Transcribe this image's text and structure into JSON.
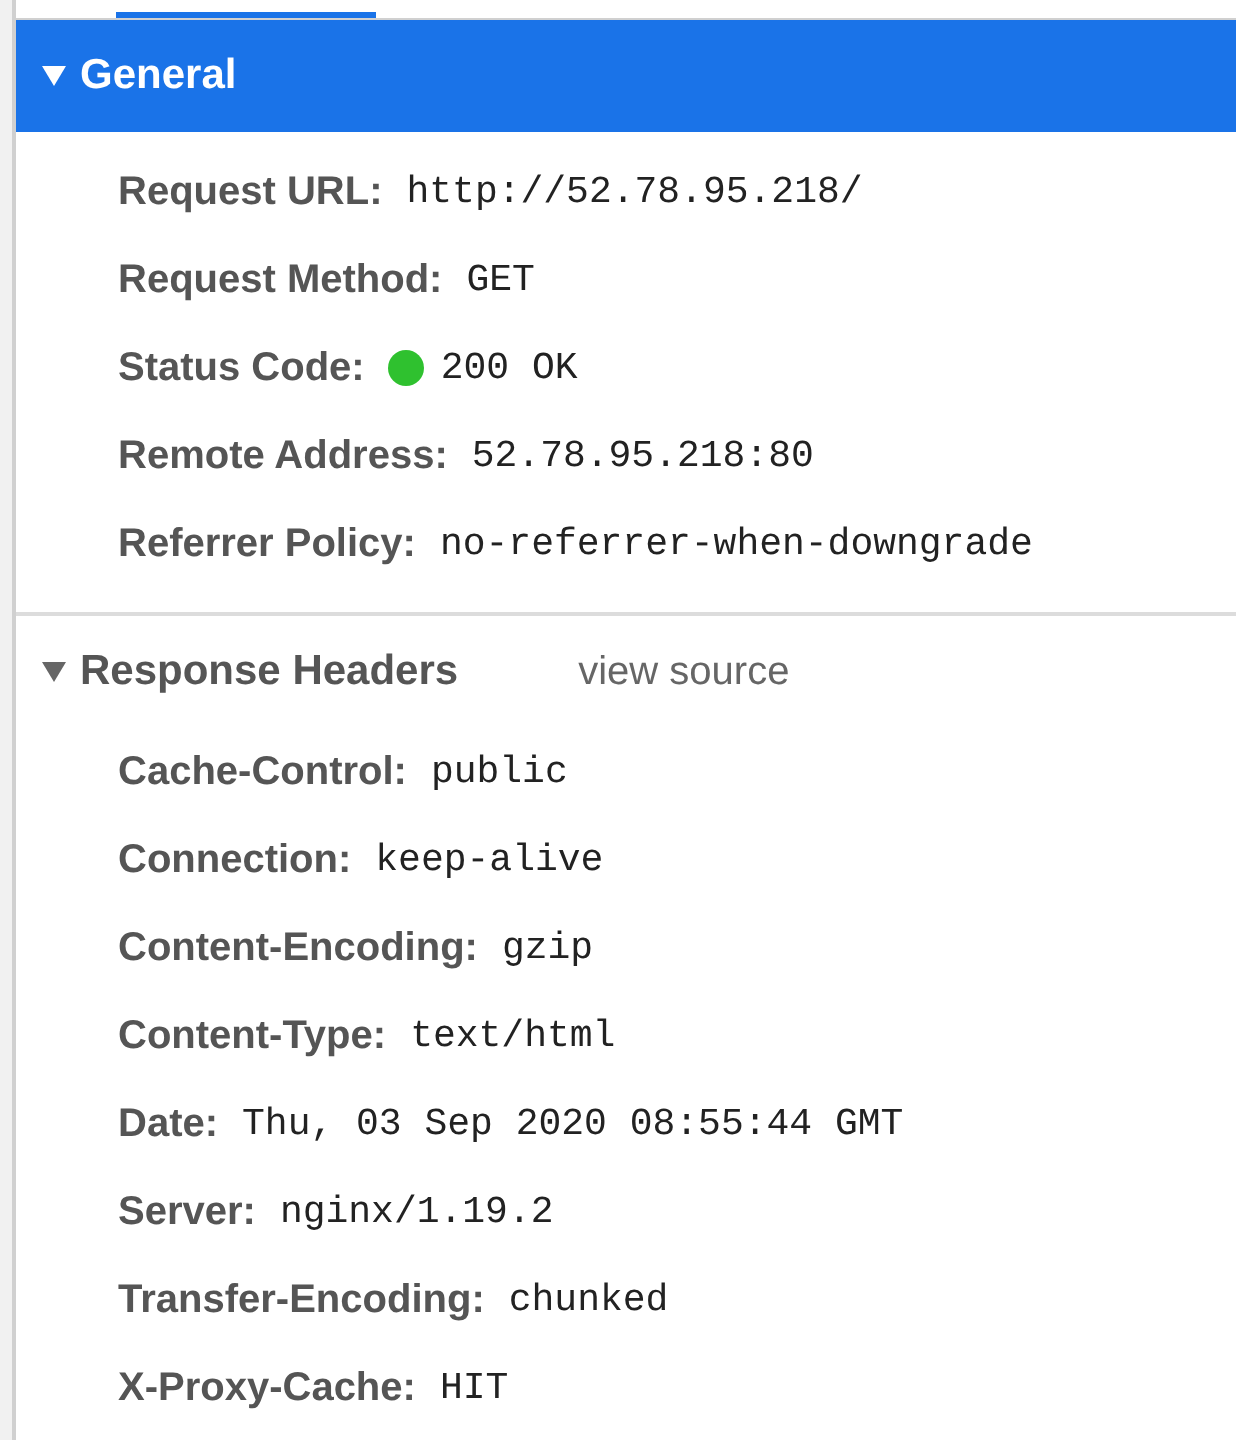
{
  "sections": [
    {
      "title": "General",
      "expanded": true,
      "selected": true,
      "rows": [
        {
          "name": "Request URL:",
          "value": "http://52.78.95.218/"
        },
        {
          "name": "Request Method:",
          "value": "GET"
        },
        {
          "name": "Status Code:",
          "value": "200 OK",
          "color": "#2fc12f"
        },
        {
          "name": "Remote Address:",
          "value": "52.78.95.218:80"
        },
        {
          "name": "Referrer Policy:",
          "value": "no-referrer-when-downgrade"
        }
      ]
    },
    {
      "title": "Response Headers",
      "expanded": true,
      "selected": false,
      "link": "view source",
      "rows": [
        {
          "name": "Cache-Control:",
          "value": "public"
        },
        {
          "name": "Connection:",
          "value": "keep-alive"
        },
        {
          "name": "Content-Encoding:",
          "value": "gzip"
        },
        {
          "name": "Content-Type:",
          "value": "text/html"
        },
        {
          "name": "Date:",
          "value": "Thu, 03 Sep 2020 08:55:44 GMT"
        },
        {
          "name": "Server:",
          "value": "nginx/1.19.2"
        },
        {
          "name": "Transfer-Encoding:",
          "value": "chunked"
        },
        {
          "name": "X-Proxy-Cache:",
          "value": "HIT"
        }
      ]
    }
  ]
}
